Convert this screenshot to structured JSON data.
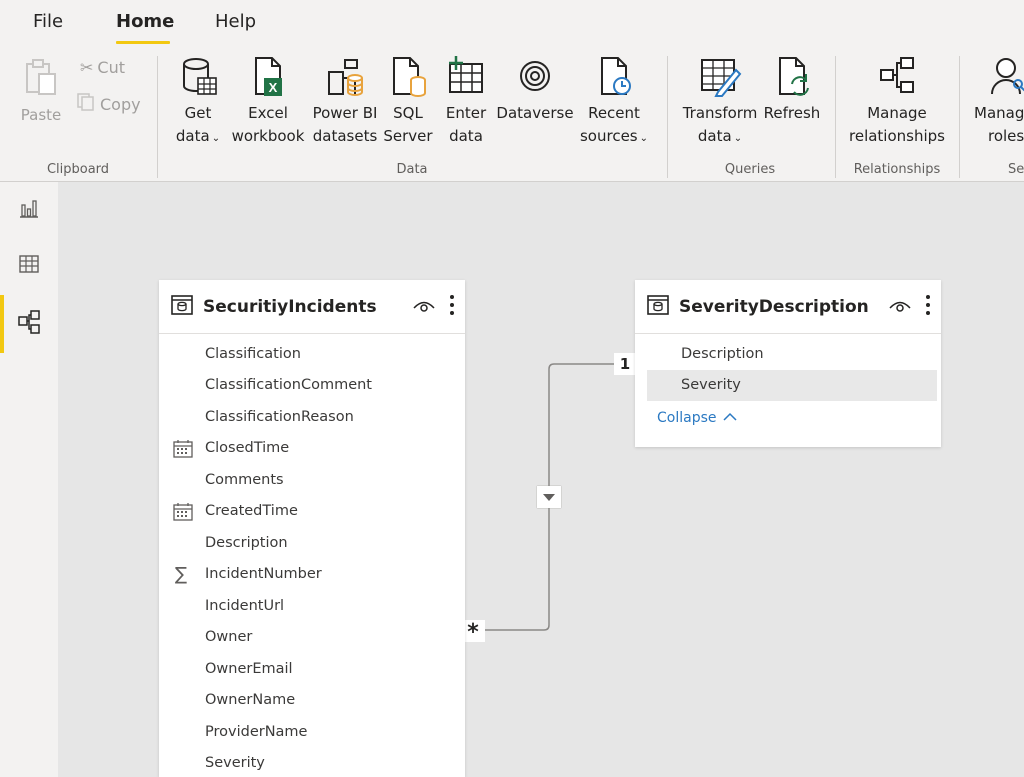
{
  "menu": {
    "file": "File",
    "home": "Home",
    "help": "Help"
  },
  "ribbon": {
    "clipboard": {
      "paste": "Paste",
      "cut": "Cut",
      "copy": "Copy",
      "group": "Clipboard"
    },
    "data": {
      "get_data": [
        "Get",
        "data"
      ],
      "excel": [
        "Excel",
        "workbook"
      ],
      "powerbi": [
        "Power BI",
        "datasets"
      ],
      "sql": [
        "SQL",
        "Server"
      ],
      "enter": [
        "Enter",
        "data"
      ],
      "dataverse": "Dataverse",
      "recent": [
        "Recent",
        "sources"
      ],
      "group": "Data"
    },
    "queries": {
      "transform": [
        "Transform",
        "data"
      ],
      "refresh": "Refresh",
      "group": "Queries"
    },
    "relationships": {
      "manage": [
        "Manage",
        "relationships"
      ],
      "group": "Relationships"
    },
    "security": {
      "manage_roles": [
        "Manag",
        "roles"
      ],
      "group": "Se"
    },
    "icon_names": [
      "paste-icon",
      "cut-icon",
      "copy-icon",
      "database-icon",
      "excel-icon",
      "powerbi-datasets-icon",
      "sql-server-icon",
      "table-icon",
      "dataverse-icon",
      "recent-sources-icon",
      "transform-icon",
      "refresh-icon",
      "relationships-icon",
      "roles-icon"
    ]
  },
  "rail": {
    "items": [
      "report-view",
      "data-view",
      "model-view"
    ],
    "active": "model-view"
  },
  "tables": {
    "left": {
      "title": "SecuritiyIncidents",
      "fields": [
        {
          "name": "Classification",
          "icon": ""
        },
        {
          "name": "ClassificationComment",
          "icon": ""
        },
        {
          "name": "ClassificationReason",
          "icon": ""
        },
        {
          "name": "ClosedTime",
          "icon": "calendar"
        },
        {
          "name": "Comments",
          "icon": ""
        },
        {
          "name": "CreatedTime",
          "icon": "calendar"
        },
        {
          "name": "Description",
          "icon": ""
        },
        {
          "name": "IncidentNumber",
          "icon": "sigma"
        },
        {
          "name": "IncidentUrl",
          "icon": ""
        },
        {
          "name": "Owner",
          "icon": ""
        },
        {
          "name": "OwnerEmail",
          "icon": ""
        },
        {
          "name": "OwnerName",
          "icon": ""
        },
        {
          "name": "ProviderName",
          "icon": ""
        },
        {
          "name": "Severity",
          "icon": ""
        }
      ]
    },
    "right": {
      "title": "SeverityDescription",
      "fields": [
        {
          "name": "Description",
          "icon": ""
        },
        {
          "name": "Severity",
          "icon": "",
          "highlighted": true
        }
      ],
      "collapse": "Collapse"
    }
  },
  "relationship": {
    "one": "1",
    "many": "*"
  },
  "colors": {
    "accent": "#f2c811",
    "link": "#2b79c2",
    "excel": "#217346",
    "sql": "#e8a33d"
  }
}
